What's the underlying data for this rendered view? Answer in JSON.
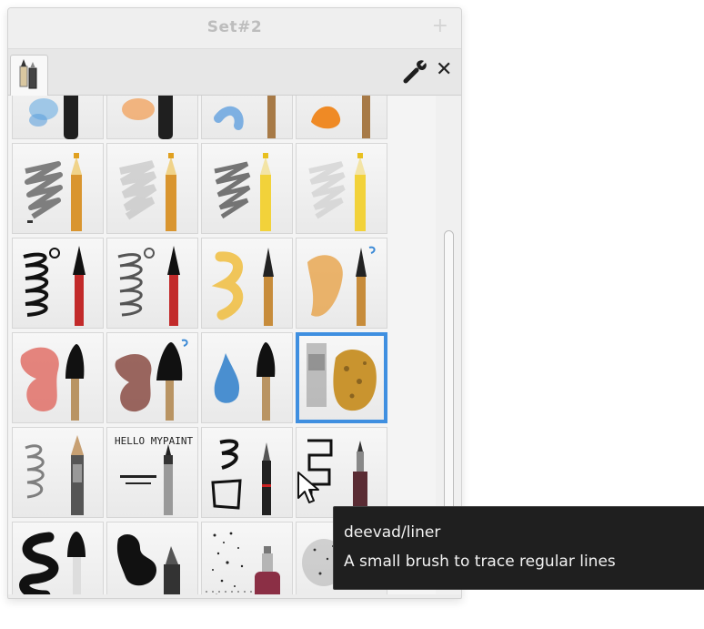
{
  "window": {
    "title": "Set#2",
    "plus_symbol": "+",
    "close_symbol": "✕"
  },
  "brush_grid": {
    "selected": "sponge-brush",
    "brushes": [
      "airbrush-blue",
      "airbrush-orange",
      "ink-blue-pen",
      "orange-pen",
      "pencil-scribble-dark",
      "pencil-scribble-light",
      "pencil-yellow",
      "pencil-light",
      "ink-scribble-black",
      "ink-scribble-grey",
      "watercolor-yellow",
      "watercolor-orange",
      "red-paint-brush",
      "brown-paint-brush",
      "blue-ink-drop",
      "sponge-brush",
      "pencil-loops",
      "hello-mypaint-liner",
      "fountain-pen-scribble",
      "deevad-liner",
      "black-ink-brush",
      "black-marker",
      "splatter-red",
      "splatter-grey"
    ],
    "hello_text": "HELLO MYPAINT !!!"
  },
  "tooltip": {
    "name": "deevad/liner",
    "description": "A small brush to trace regular lines"
  },
  "colors": {
    "selection": "#3f8fe0",
    "tooltip_bg": "#1f1f1f",
    "tooltip_text": "#f2f2f2"
  }
}
